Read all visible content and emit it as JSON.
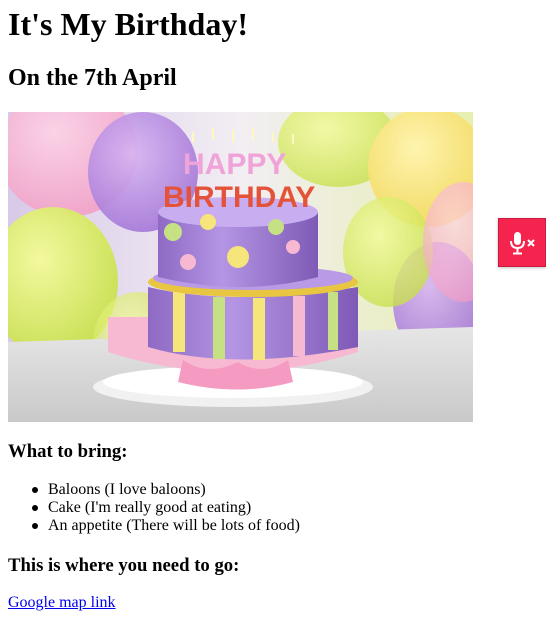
{
  "page": {
    "heading": "It's My Birthday!",
    "subheading": "On the 7th April"
  },
  "hero_image": {
    "candle_text_top": "HAPPY",
    "candle_text_bottom": "BIRTHDAY"
  },
  "bring": {
    "heading": "What to bring:",
    "items": [
      "Baloons (I love baloons)",
      "Cake (I'm really good at eating)",
      "An appetite (There will be lots of food)"
    ]
  },
  "directions": {
    "heading": "This is where you need to go:",
    "link_text": "Google map link"
  },
  "mic_widget": {
    "icon": "microphone-muted-icon",
    "color": "#f5244e"
  }
}
